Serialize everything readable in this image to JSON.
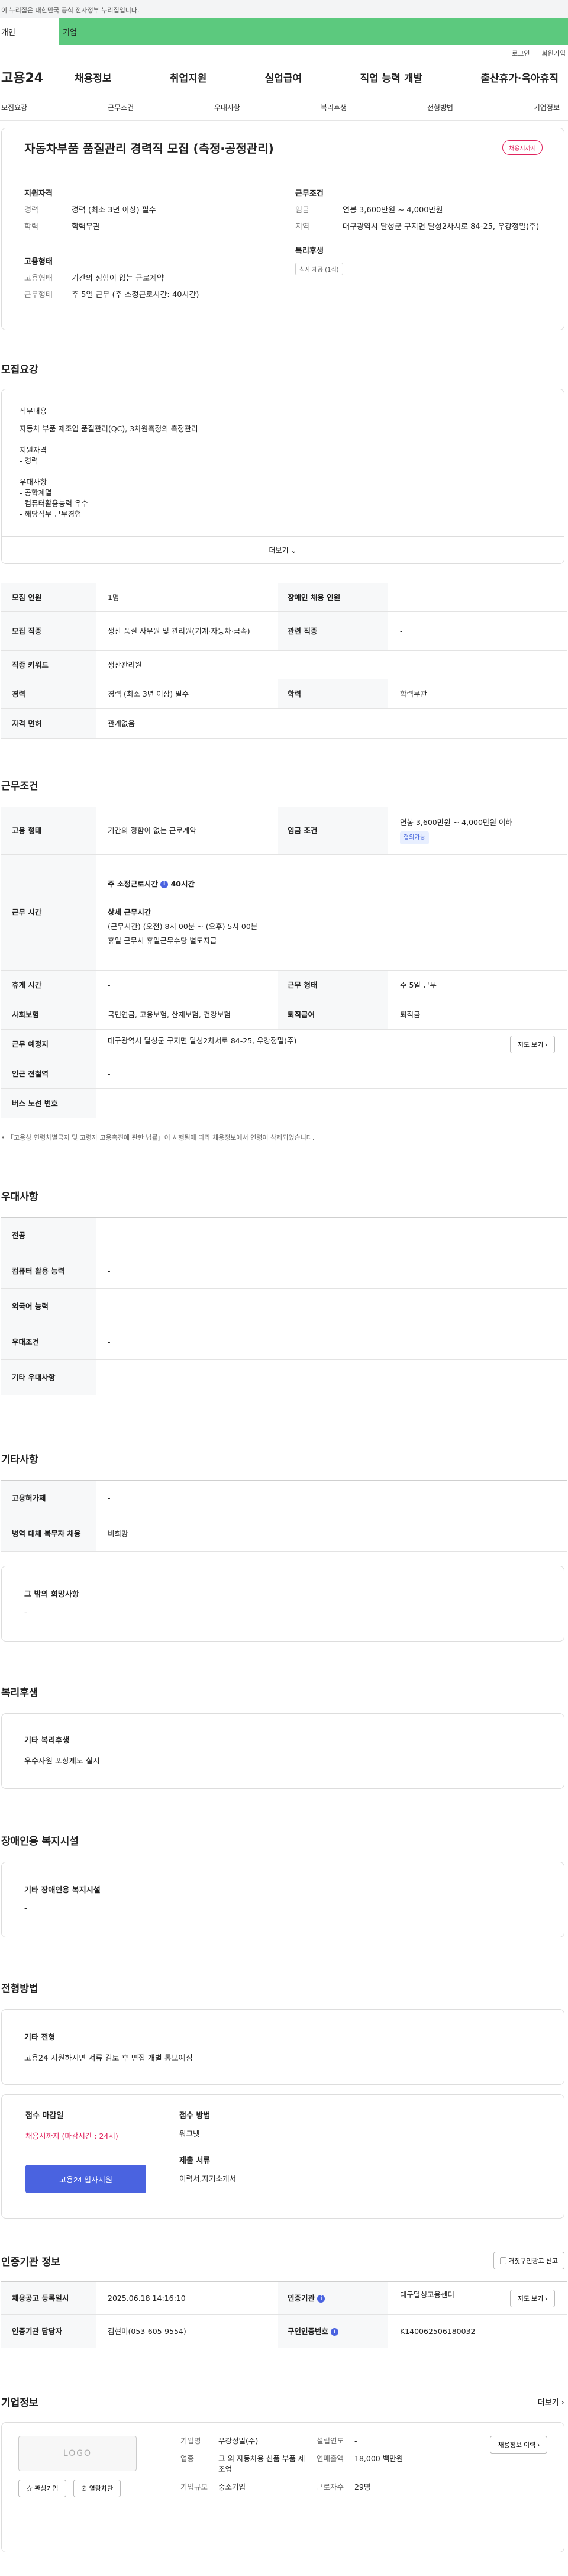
{
  "gov_bar": "이 누리집은 대한민국 공식 전자정부 누리집입니다.",
  "top_tabs": [
    "개인",
    "기업"
  ],
  "util": [
    "로그인",
    "회원가입"
  ],
  "logo": "고용24",
  "gnb": [
    "채용정보",
    "취업지원",
    "실업급여",
    "직업 능력 개발",
    "출산휴가·육아휴직"
  ],
  "snb": [
    "모집요강",
    "근무조건",
    "우대사항",
    "복리후생",
    "전형방법",
    "기업정보"
  ],
  "summary": {
    "title": "자동차부품 품질관리 경력직 모집 (측정·공정관리)",
    "badge": "채용시까지",
    "qual_head": "지원자격",
    "qual": [
      {
        "k": "경력",
        "v": "경력 (최소 3년 이상) 필수"
      },
      {
        "k": "학력",
        "v": "학력무관"
      }
    ],
    "emp_head": "고용형태",
    "emp": [
      {
        "k": "고용형태",
        "v": "기간의 정함이 없는 근로계약"
      },
      {
        "k": "근무형태",
        "v": "주 5일 근무 (주 소정근로시간: 40시간)"
      }
    ],
    "cond_head": "근무조건",
    "cond": [
      {
        "k": "임금",
        "v": "연봉 3,600만원 ~ 4,000만원"
      },
      {
        "k": "지역",
        "v": "대구광역시 달성군 구지면 달성2차서로 84-25, 우강정밀(주)"
      }
    ],
    "welfare_head": "복리후생",
    "welfare_chip": "식사 제공 (1식)"
  },
  "recruit": {
    "title": "모집요강",
    "duty_head": "직무내용",
    "duty": "자동차 부품 제조업 품질관리(QC), 3차원측정의 측정관리",
    "req_head": "지원자격",
    "req": "- 경력",
    "pref_head": "우대사항",
    "pref": [
      "- 공학계열",
      "- 컴퓨터활용능력 우수",
      "- 해당직무 근무경험"
    ],
    "more": "더보기",
    "rows": [
      {
        "k": "모집 인원",
        "v": "1명",
        "k2": "장애인 채용 인원",
        "v2": "-"
      },
      {
        "k": "모집 직종",
        "v": "생산 품질 사무원 및 관리원(기계·자동차·금속)",
        "k2": "관련 직종",
        "v2": "-"
      },
      {
        "k": "직종 키워드",
        "v": "생산관리원"
      },
      {
        "k": "경력",
        "v": "경력 (최소 3년 이상) 필수",
        "k2": "학력",
        "v2": "학력무관"
      },
      {
        "k": "자격 면허",
        "v": "관계없음"
      }
    ]
  },
  "work": {
    "title": "근무조건",
    "emp_type_k": "고용 형태",
    "emp_type_v": "기간의 정함이 없는 근로계약",
    "wage_k": "임금 조건",
    "wage_v": "연봉 3,600만원 ~ 4,000만원 이하",
    "wage_tag": "협의가능",
    "hours_k": "근무 시간",
    "hours_week": "주 소정근로시간",
    "hours_week_v": "40시간",
    "hours_detail_t": "상세 근무시간",
    "hours_detail": "(근무시간) (오전) 8시 00분 ~ (오후) 5시 00분",
    "hours_holiday": "휴일 근무시 휴일근무수당 별도지급",
    "rest_k": "휴게 시간",
    "rest_v": "-",
    "shape_k": "근무 형태",
    "shape_v": "주 5일 근무",
    "ins_k": "사회보험",
    "ins_v": "국민연금, 고용보험, 산재보험, 건강보험",
    "retire_k": "퇴직급여",
    "retire_v": "퇴직금",
    "place_k": "근무 예정지",
    "place_v": "대구광역시 달성군 구지면 달성2차서로 84-25, 우강정밀(주)",
    "map_btn": "지도 보기",
    "sub_k": "인근 전철역",
    "sub_v": "-",
    "bus_k": "버스 노선 번호",
    "bus_v": "-",
    "note": "「고용상 연령차별금지 및 고령자 고용촉진에 관한 법률」이 시행됨에 따라 채용정보에서 연령이 삭제되었습니다."
  },
  "pref": {
    "title": "우대사항",
    "rows": [
      {
        "k": "전공",
        "v": "-"
      },
      {
        "k": "컴퓨터 활용 능력",
        "v": "-"
      },
      {
        "k": "외국어 능력",
        "v": "-"
      },
      {
        "k": "우대조건",
        "v": "-"
      },
      {
        "k": "기타 우대사항",
        "v": "-"
      }
    ]
  },
  "etc": {
    "title": "기타사항",
    "rows": [
      {
        "k": "고용허가제",
        "v": "-"
      },
      {
        "k": "병역 대체 복무자 채용",
        "v": "비희망"
      }
    ],
    "hope_t": "그 밖의 희망사항",
    "hope_v": "-"
  },
  "benefit": {
    "title": "복리후생",
    "box_t": "기타 복리후생",
    "box_v": "우수사원 포상제도 실시"
  },
  "disabled": {
    "title": "장애인용 복지시설",
    "box_t": "기타 장애인용 복지시설",
    "box_v": "-"
  },
  "process": {
    "title": "전형방법",
    "box_t": "기타 전형",
    "box_v": "고용24 지원하시면 서류 검토 후 면접 개별 통보예정",
    "deadline_t": "접수 마감일",
    "deadline_v": "채용시까지 (마감시간 : 24시)",
    "apply_btn": "고용24 입사지원",
    "method_t": "접수 방법",
    "method_v": "워크넷",
    "docs_t": "제출 서류",
    "docs_v": "이력서,자기소개서"
  },
  "cert": {
    "title": "인증기관 정보",
    "report_btn": "거짓구인광고 신고",
    "reg_k": "채용공고 등록일시",
    "reg_v": "2025.06.18 14:16:10",
    "org_k": "인증기관",
    "org_v": "대구달성고용센터",
    "map_btn": "지도 보기",
    "mgr_k": "인증기관 담당자",
    "mgr_v": "김현미(053-605-9554)",
    "id_k": "구인인증번호",
    "id_v": "K140062506180032"
  },
  "company": {
    "title": "기업정보",
    "more": "더보기",
    "logo": "LOGO",
    "fav_btn": "관심기업",
    "block_btn": "열람차단",
    "name_k": "기업명",
    "name_v": "우강정밀(주)",
    "year_k": "설립연도",
    "year_v": "-",
    "ind_k": "업종",
    "ind_v": "그 외 자동차용 신품 부품 제조업",
    "sales_k": "연매출액",
    "sales_v": "18,000 백만원",
    "emp_k": "근로자수",
    "emp_v": "29명",
    "size_k": "기업규모",
    "size_v": "중소기업",
    "jobs_btn": "채용정보 이력"
  }
}
